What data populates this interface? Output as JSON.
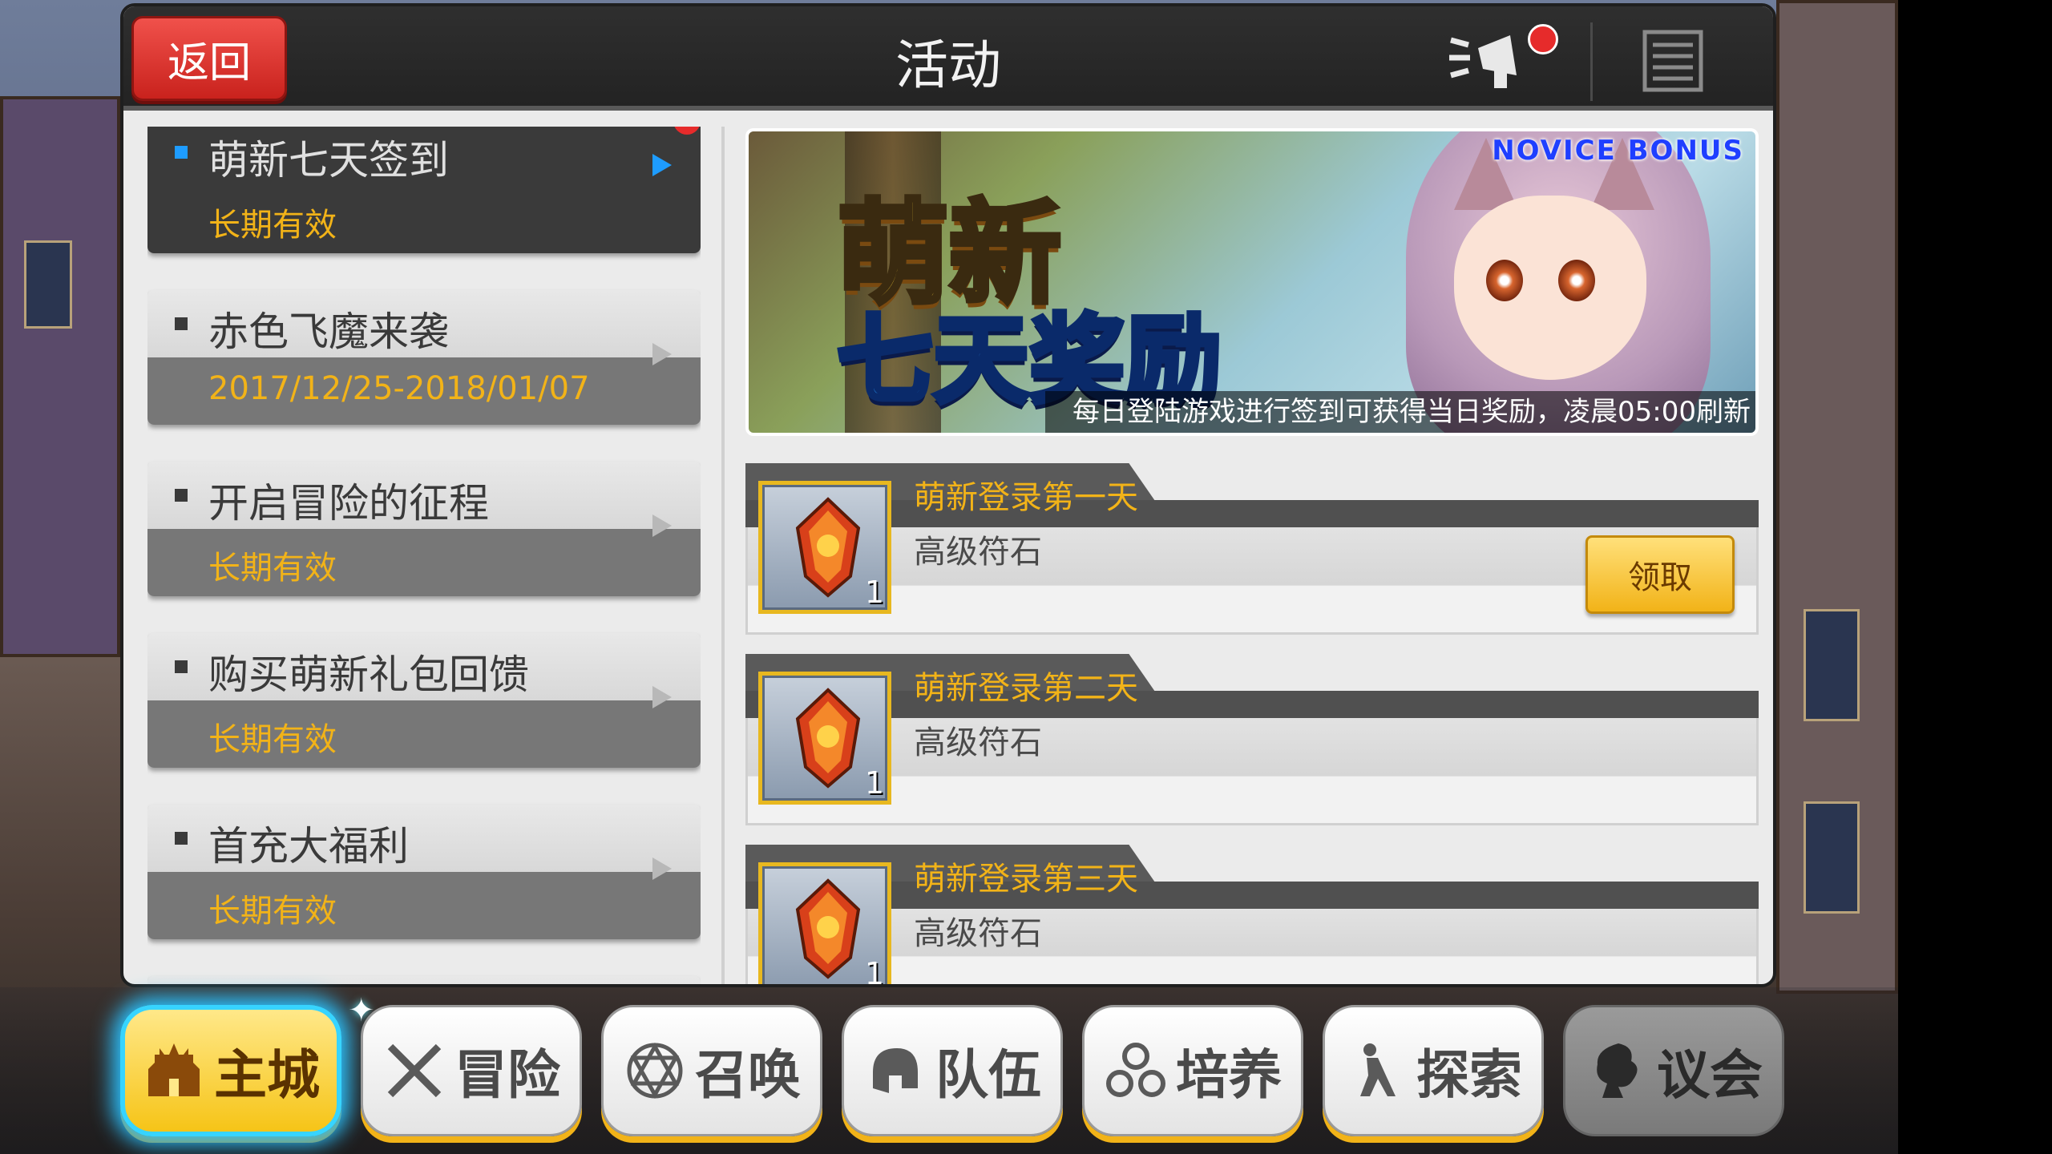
{
  "header": {
    "back_label": "返回",
    "title": "活动"
  },
  "activities": [
    {
      "name": "萌新七天签到",
      "period": "长期有效",
      "active": true,
      "has_notice": true
    },
    {
      "name": "赤色飞魔来袭",
      "period": "2017/12/25-2018/01/07",
      "active": false
    },
    {
      "name": "开启冒险的征程",
      "period": "长期有效",
      "active": false
    },
    {
      "name": "购买萌新礼包回馈",
      "period": "长期有效",
      "active": false
    },
    {
      "name": "首充大福利",
      "period": "长期有效",
      "active": false
    }
  ],
  "banner": {
    "tag": "NOVICE BONUS",
    "headline_1": "萌新",
    "headline_2": "七天奖励",
    "caption": "每日登陆游戏进行签到可获得当日奖励，凌晨05:00刷新"
  },
  "rewards": [
    {
      "day": "萌新登录第一天",
      "item": "高级符石",
      "qty": "1",
      "claim_label": "领取"
    },
    {
      "day": "萌新登录第二天",
      "item": "高级符石",
      "qty": "1"
    },
    {
      "day": "萌新登录第三天",
      "item": "高级符石",
      "qty": "1"
    }
  ],
  "nav": [
    {
      "label": "主城",
      "icon": "castle-icon"
    },
    {
      "label": "冒险",
      "icon": "crossed-swords-icon"
    },
    {
      "label": "召唤",
      "icon": "hexagram-icon"
    },
    {
      "label": "队伍",
      "icon": "helmet-icon"
    },
    {
      "label": "培养",
      "icon": "gears-icon"
    },
    {
      "label": "探索",
      "icon": "explorer-icon"
    },
    {
      "label": "议会",
      "icon": "lion-crest-icon"
    }
  ],
  "colors": {
    "accent_gold": "#f2b318",
    "back_red": "#e63a34",
    "selected_glow": "#2cc3ff"
  }
}
